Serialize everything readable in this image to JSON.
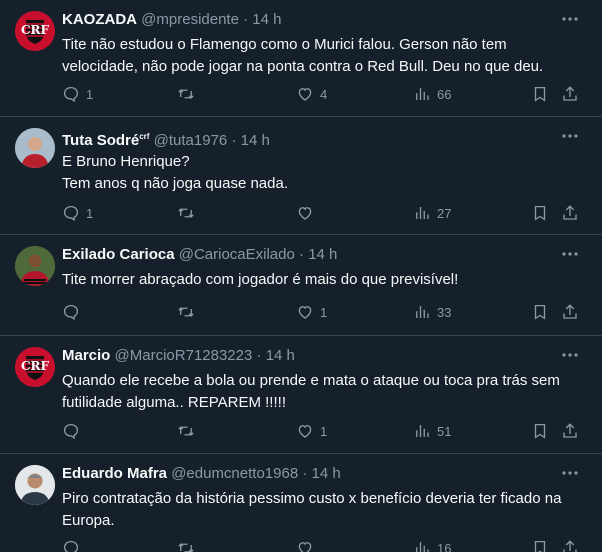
{
  "colors": {
    "background": "#15202b",
    "divider": "#38444d",
    "muted_text": "#8b98a5",
    "text": "#f7f9f9",
    "flamengo_red": "#c8102e",
    "flamengo_black": "#111111"
  },
  "tweets": [
    {
      "display_name": "KAOZADA",
      "handle": "@mpresidente",
      "separator": "·",
      "time": "14 h",
      "text": "Tite não estudou o Flamengo como o Murici falou. Gerson não tem velocidade, não pode jogar na ponta contra o Red Bull. Deu no que deu.",
      "replies": "1",
      "retweets": "",
      "likes": "4",
      "views": "66",
      "avatar": "flamengo-crest"
    },
    {
      "display_name": "Tuta Sodré",
      "name_badge": "crf",
      "handle": "@tuta1976",
      "separator": "·",
      "time": "14 h",
      "text": "E Bruno Henrique?\nTem anos q não joga quase nada.",
      "replies": "1",
      "retweets": "",
      "likes": "",
      "views": "27",
      "avatar": "person-photo"
    },
    {
      "display_name": "Exilado Carioca",
      "handle": "@CariocaExilado",
      "separator": "·",
      "time": "14 h",
      "text": "Tite morrer abraçado com jogador é mais do que previsível!",
      "replies": "",
      "retweets": "",
      "likes": "1",
      "views": "33",
      "avatar": "player-photo"
    },
    {
      "display_name": "Marcio",
      "handle": "@MarcioR71283223",
      "separator": "·",
      "time": "14 h",
      "text": "Quando ele recebe a bola ou prende e mata o ataque ou toca pra trás sem futilidade alguma.. REPAREM !!!!!",
      "replies": "",
      "retweets": "",
      "likes": "1",
      "views": "51",
      "avatar": "flamengo-crest"
    },
    {
      "display_name": "Eduardo Mafra",
      "handle": "@edumcnetto1968",
      "separator": "·",
      "time": "14 h",
      "text": "Piro contratação da história pessimo custo x benefício deveria ter ficado na Europa.",
      "replies": "",
      "retweets": "",
      "likes": "",
      "views": "16",
      "avatar": "person-photo"
    }
  ],
  "icons": {
    "reply": "reply-icon",
    "retweet": "retweet-icon",
    "like": "heart-icon",
    "views": "views-icon",
    "bookmark": "bookmark-icon",
    "share": "share-icon",
    "more": "more-icon"
  }
}
